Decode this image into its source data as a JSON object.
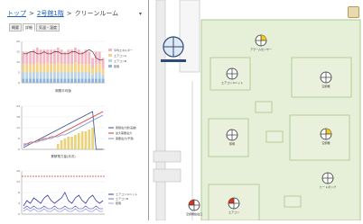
{
  "breadcrumb": {
    "items": [
      "トップ",
      "2号館1階",
      "クリーンルーム"
    ],
    "separator": ">"
  },
  "panel_tabs": [
    "概要",
    "詳細",
    "気温・湿度"
  ],
  "charts": {
    "chart1_legend": [
      "平均エネルギー",
      "エアコンA",
      "エアコンB",
      "照明"
    ],
    "chart1_xlabel": "期間平均値",
    "chart2_legend": [
      "累積電力量(実績)",
      "最大需要電力",
      "需要電力(予測)"
    ],
    "chart2_xlabel": "累積電力量(月次)",
    "chart3_legend": [
      "エアコンユニット",
      "エアコンB",
      "照明"
    ]
  },
  "chart_data": [
    {
      "type": "bar",
      "categories": [
        "1",
        "2",
        "3",
        "4",
        "5",
        "6",
        "7",
        "8",
        "9",
        "10",
        "11",
        "12",
        "13",
        "14",
        "15",
        "16",
        "17",
        "18",
        "19",
        "20",
        "21",
        "22",
        "23",
        "24"
      ],
      "series": [
        {
          "name": "平均エネルギー",
          "values": [
            6,
            6,
            6,
            7,
            7,
            7,
            7,
            6,
            7,
            7,
            7,
            7,
            6,
            7,
            7,
            7,
            7,
            6,
            7,
            6,
            5,
            6,
            6,
            5
          ]
        },
        {
          "name": "エアコンA",
          "values": [
            4,
            4,
            4,
            4,
            5,
            4,
            4,
            5,
            4,
            4,
            5,
            4,
            4,
            4,
            4,
            5,
            4,
            4,
            4,
            4,
            3,
            4,
            4,
            3
          ]
        },
        {
          "name": "エアコンB",
          "values": [
            3,
            3,
            3,
            3,
            3,
            3,
            3,
            3,
            3,
            3,
            3,
            3,
            3,
            3,
            3,
            3,
            3,
            3,
            3,
            3,
            2,
            3,
            3,
            2
          ]
        },
        {
          "name": "照明",
          "values": [
            2,
            2,
            2,
            2,
            2,
            2,
            2,
            2,
            2,
            2,
            2,
            2,
            2,
            2,
            2,
            2,
            2,
            2,
            2,
            2,
            2,
            2,
            2,
            2
          ]
        }
      ],
      "line": [
        14,
        14,
        15,
        15,
        14,
        14,
        15,
        14,
        14,
        15,
        15,
        14,
        14,
        14,
        15,
        15,
        14,
        14,
        15,
        16,
        15,
        12,
        11,
        11
      ],
      "ylim": [
        0,
        20
      ],
      "grid": true
    },
    {
      "type": "bar",
      "categories": [
        "1",
        "2",
        "3",
        "4",
        "5",
        "6",
        "7",
        "8",
        "9",
        "10",
        "11",
        "12",
        "13",
        "14",
        "15",
        "16",
        "17",
        "18",
        "19",
        "20",
        "21",
        "22",
        "23",
        "24"
      ],
      "values": [
        0,
        0,
        0,
        0,
        0,
        0,
        0,
        0,
        0,
        0,
        3,
        5,
        6,
        7,
        7,
        8,
        9,
        10,
        10,
        11,
        12,
        0,
        0,
        0
      ],
      "series": [
        {
          "name": "累積電力量(実績)",
          "values": [
            1,
            2,
            3,
            4,
            5,
            6,
            7,
            8,
            9,
            10,
            11,
            12,
            13,
            14,
            15,
            16,
            17,
            18,
            19,
            20,
            21,
            0,
            0,
            0
          ]
        },
        {
          "name": "最大需要電力",
          "values": [
            3,
            3,
            4,
            4,
            5,
            5,
            6,
            6,
            7,
            7,
            8,
            9,
            10,
            11,
            12,
            13,
            14,
            15,
            16,
            17,
            18,
            19,
            20,
            21
          ]
        },
        {
          "name": "需要電力(予測)",
          "values": [
            2,
            3,
            3,
            4,
            4,
            5,
            5,
            6,
            6,
            7,
            7,
            8,
            8,
            9,
            10,
            11,
            12,
            13,
            14,
            15,
            16,
            17,
            18,
            19
          ]
        }
      ],
      "ylim": [
        0,
        24
      ],
      "grid": true
    },
    {
      "type": "line",
      "x": [
        "1",
        "2",
        "3",
        "4",
        "5",
        "6",
        "7",
        "8",
        "9",
        "10",
        "11",
        "12",
        "13",
        "14",
        "15",
        "16",
        "17",
        "18",
        "19",
        "20",
        "21",
        "22",
        "23",
        "24"
      ],
      "series": [
        {
          "name": "エアコンユニット",
          "values": [
            3,
            5,
            4,
            6,
            5,
            4,
            6,
            7,
            5,
            4,
            5,
            6,
            8,
            5,
            4,
            6,
            7,
            5,
            4,
            6,
            7,
            5,
            4,
            5
          ]
        },
        {
          "name": "エアコンB",
          "values": [
            2,
            3,
            2,
            3,
            2,
            2,
            3,
            2,
            2,
            3,
            2,
            2,
            3,
            2,
            2,
            3,
            2,
            2,
            3,
            2,
            2,
            3,
            2,
            2
          ]
        },
        {
          "name": "照明",
          "values": [
            1,
            2,
            1,
            2,
            1,
            1,
            2,
            1,
            1,
            2,
            1,
            1,
            2,
            1,
            1,
            2,
            1,
            1,
            2,
            1,
            1,
            2,
            1,
            1
          ]
        }
      ],
      "threshold": 14,
      "ylim": [
        0,
        16
      ],
      "grid": true
    }
  ],
  "map": {
    "sensors": [
      {
        "label": "アラームセンサー",
        "status": "partial-yellow"
      },
      {
        "label": "エアコンユニット",
        "status": "normal"
      },
      {
        "label": "空調機",
        "status": "normal"
      },
      {
        "label": "照明",
        "status": "normal"
      },
      {
        "label": "空調機",
        "status": "partial-yellow"
      },
      {
        "label": "ヒートポンプ",
        "status": "normal"
      },
      {
        "label": "エアコン",
        "status": "partial-red"
      },
      {
        "label": "空調機給電口",
        "status": "partial-red"
      }
    ],
    "room_label": "クリーンルーム",
    "colors": {
      "room": "#e6efd8",
      "room_border": "#9fbf7a",
      "wall": "#cfcfcf",
      "inner_room": "#e9f1dc"
    }
  }
}
